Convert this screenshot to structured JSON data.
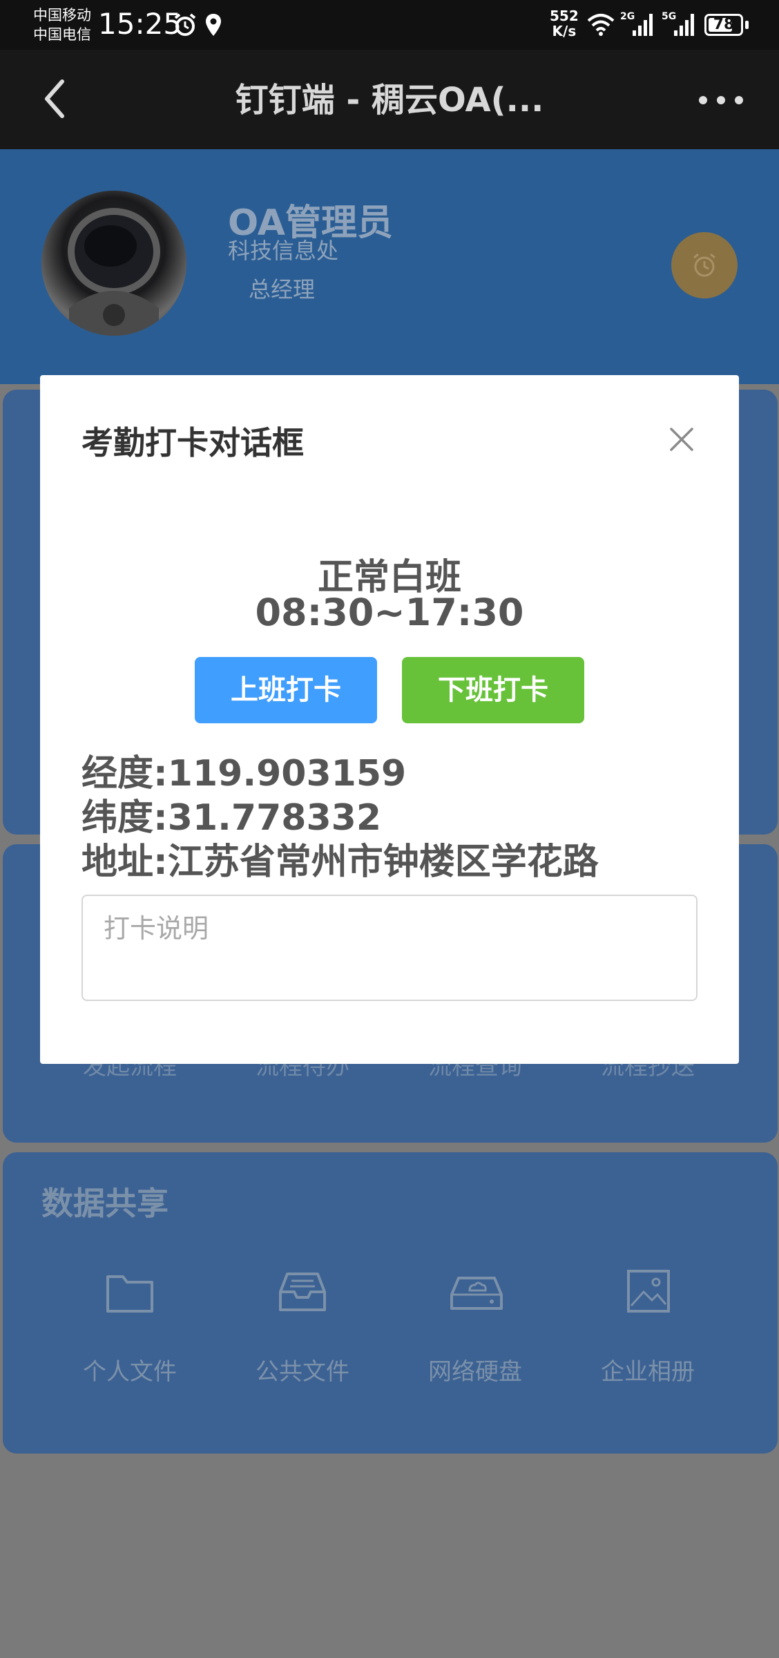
{
  "status_bar": {
    "carrier1": "中国移动",
    "carrier2": "中国电信",
    "time": "15:25",
    "net_speed_value": "552",
    "net_speed_unit": "K/s",
    "network1": "2G",
    "network2": "5G",
    "battery": "78",
    "battery_level_percent": 78,
    "icons": [
      "alarm-icon",
      "location-icon",
      "wifi-icon",
      "signal-icon",
      "battery-icon"
    ]
  },
  "nav": {
    "title": "钉钉端 - 稠云OA(...",
    "icons": [
      "back-arrow-icon",
      "more-icon"
    ]
  },
  "profile": {
    "name": "OA管理员",
    "department": "科技信息处",
    "role": "总经理"
  },
  "process_section": {
    "items": [
      "发起流程",
      "流程待办",
      "流程查询",
      "流程抄送"
    ]
  },
  "share_section": {
    "title": "数据共享",
    "items": [
      {
        "label": "个人文件",
        "icon": "folder-icon"
      },
      {
        "label": "公共文件",
        "icon": "inbox-icon"
      },
      {
        "label": "网络硬盘",
        "icon": "cloud-drive-icon"
      },
      {
        "label": "企业相册",
        "icon": "image-icon"
      }
    ]
  },
  "dialog": {
    "title": "考勤打卡对话框",
    "shift_name": "正常白班",
    "shift_time": "08:30~17:30",
    "clock_in_label": "上班打卡",
    "clock_out_label": "下班打卡",
    "longitude": "经度:119.903159",
    "latitude": "纬度:31.778332",
    "address": "地址:江苏省常州市钟楼区学花路",
    "remark_placeholder": "打卡说明",
    "remark_value": ""
  },
  "colors": {
    "primary_button": "#409eff",
    "success_button": "#67c23a",
    "header_blue": "#2a5d94",
    "overlay_gray": "#7a7a7a",
    "alarm_button": "#8a7242"
  }
}
